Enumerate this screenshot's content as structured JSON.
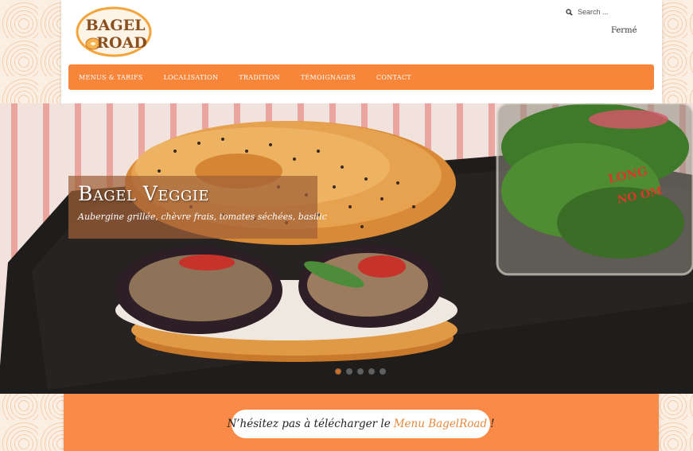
{
  "logo": {
    "line1": "BAGEL",
    "line2": "ROAD",
    "colors": {
      "text": "#8a4f1f",
      "ring": "#f3a43b"
    }
  },
  "search": {
    "placeholder": "Search ..."
  },
  "status": {
    "text": "Fermé"
  },
  "nav": {
    "items": [
      {
        "label": "MENUS & TARIFS"
      },
      {
        "label": "LOCALISATION"
      },
      {
        "label": "TRADITION"
      },
      {
        "label": "TÉMOIGNAGES"
      },
      {
        "label": "CONTACT"
      }
    ],
    "color": "#f7853a"
  },
  "hero": {
    "title": "Bagel Veggie",
    "subtitle": "Aubergine grillée, chèvre frais, tomates séchées, basilic",
    "slides": 5,
    "active_slide": 1
  },
  "banner": {
    "text_before": "N’hésitez pas à télécharger le",
    "link": "Menu BagelRoad",
    "text_after": "!",
    "color": "#fa8a47",
    "link_color": "#e6893f"
  }
}
